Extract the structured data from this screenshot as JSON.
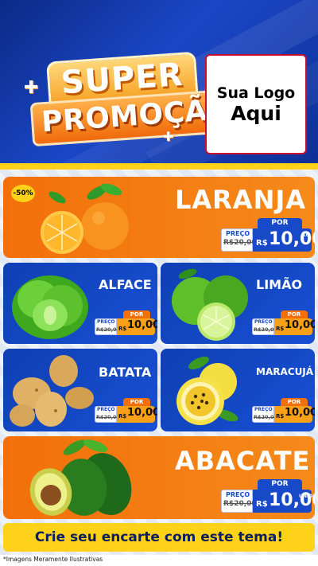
{
  "header": {
    "title_line1": "SUPER",
    "title_line2": "PROMOÇÃO",
    "logo_line1": "Sua Logo",
    "logo_line2": "Aqui"
  },
  "products": {
    "laranja": {
      "name": "LARANJA",
      "badge": "-50%",
      "por": "POR",
      "preco": "PREÇO",
      "old": "R$20,00",
      "rs": "R$",
      "value": "10,00",
      "unit": "KG"
    },
    "alface": {
      "name": "ALFACE",
      "por": "POR",
      "preco": "PREÇO",
      "old": "R$20,00",
      "rs": "R$",
      "value": "10,00",
      "unit": "KG"
    },
    "limao": {
      "name": "LIMÃO",
      "por": "POR",
      "preco": "PREÇO",
      "old": "R$20,00",
      "rs": "R$",
      "value": "10,00",
      "unit": "KG"
    },
    "batata": {
      "name": "BATATA",
      "por": "POR",
      "preco": "PREÇO",
      "old": "R$20,00",
      "rs": "R$",
      "value": "10,00",
      "unit": "KG"
    },
    "maracuja": {
      "name": "MARACUJÁ",
      "por": "POR",
      "preco": "PREÇO",
      "old": "R$20,00",
      "rs": "R$",
      "value": "10,00",
      "unit": "KG"
    },
    "abacate": {
      "name": "ABACATE",
      "por": "POR",
      "preco": "PREÇO",
      "old": "R$20,00",
      "rs": "R$",
      "value": "10,00",
      "unit": "UNID"
    }
  },
  "cta": "Crie seu encarte com este tema!",
  "footer_note": "*Imagens Meramente Ilustrativas",
  "colors": {
    "orange": "#f36f0a",
    "blue": "#1749c9",
    "yellow": "#ffd21a",
    "navy": "#0b2a86"
  }
}
